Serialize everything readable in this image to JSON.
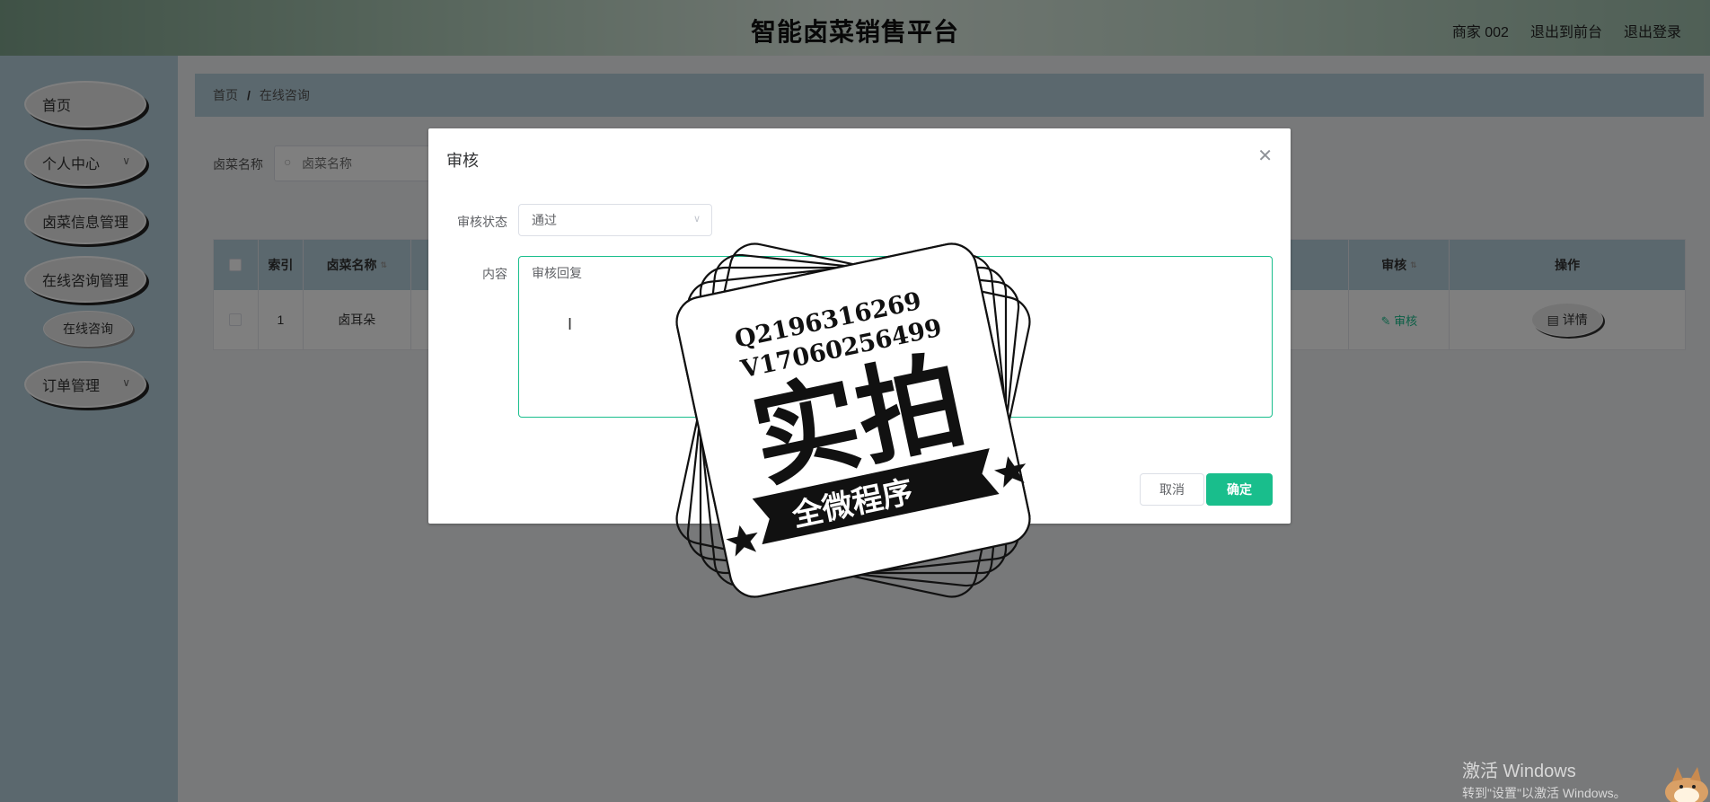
{
  "header": {
    "title": "智能卤菜销售平台",
    "user": "商家 002",
    "to_front": "退出到前台",
    "logout": "退出登录"
  },
  "sidebar": {
    "items": [
      {
        "label": "首页"
      },
      {
        "label": "个人中心"
      },
      {
        "label": "卤菜信息管理"
      },
      {
        "label": "在线咨询管理"
      },
      {
        "label": "在线咨询"
      },
      {
        "label": "订单管理"
      }
    ]
  },
  "breadcrumb": {
    "home": "首页",
    "sep": "/",
    "current": "在线咨询"
  },
  "search": {
    "label": "卤菜名称",
    "placeholder": "卤菜名称"
  },
  "table": {
    "headers": {
      "index": "索引",
      "name": "卤菜名称",
      "audit": "审核",
      "op": "操作"
    },
    "rows": [
      {
        "index": "1",
        "name": "卤耳朵",
        "audit": "审核",
        "detail": "详情"
      }
    ]
  },
  "dialog": {
    "title": "审核",
    "status_label": "审核状态",
    "status_value": "通过",
    "content_label": "内容",
    "content_value": "审核回复",
    "cancel": "取消",
    "confirm": "确定"
  },
  "stamp": {
    "line1": "Q2196316269",
    "line2": "V17060256499",
    "main": "实拍",
    "banner": "全微程序"
  },
  "watermark": {
    "line1": "激活 Windows",
    "line2": "转到\"设置\"以激活 Windows。"
  },
  "colors": {
    "accent": "#19be8c",
    "sidebar": "#b7d0dc"
  },
  "icons": {
    "close": "close-icon",
    "search": "search-icon",
    "chevron": "chevron-down-icon"
  }
}
